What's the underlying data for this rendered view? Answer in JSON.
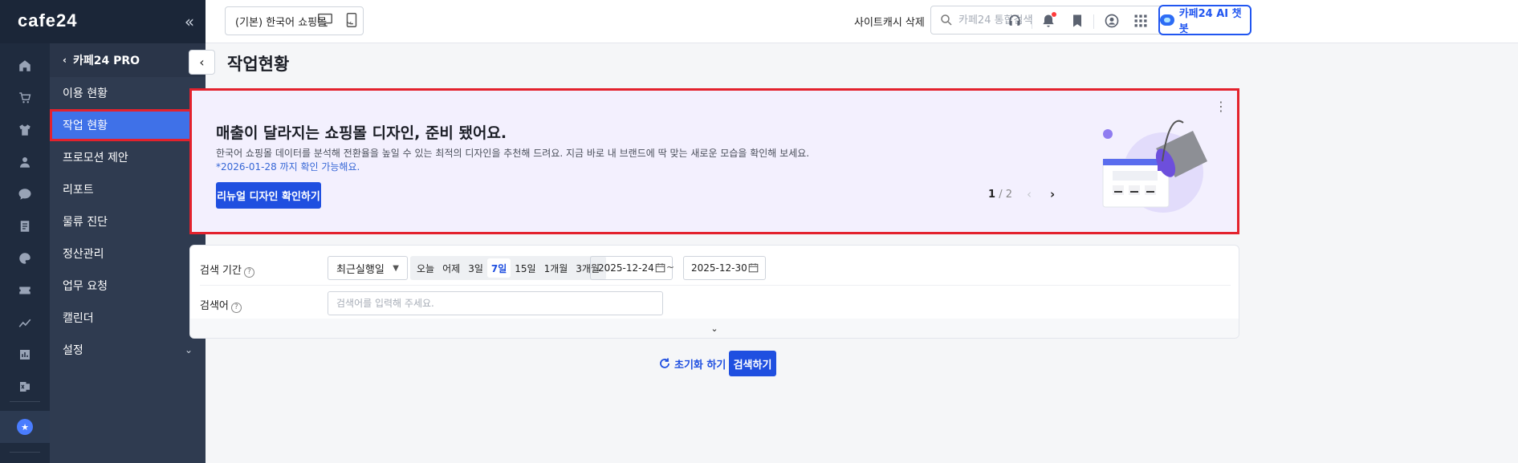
{
  "app": {
    "logo": "cafe24",
    "collapse_label": "«"
  },
  "rail": {
    "icons": [
      "home-icon",
      "cart-icon",
      "shirt-icon",
      "user-icon",
      "chat-icon",
      "document-icon",
      "palette-icon",
      "ticket-icon",
      "chart-line-icon",
      "bar-chart-icon",
      "excel-icon"
    ],
    "active_icon": "pro-badge-icon"
  },
  "submenu": {
    "header": "카페24 PRO",
    "items": [
      {
        "label": "이용 현황"
      },
      {
        "label": "작업 현황"
      },
      {
        "label": "프로모션 제안"
      },
      {
        "label": "리포트"
      },
      {
        "label": "물류 진단"
      },
      {
        "label": "정산관리"
      },
      {
        "label": "업무 요청"
      },
      {
        "label": "캘린더"
      },
      {
        "label": "설정"
      }
    ]
  },
  "topbar": {
    "shop_select": "(기본) 한국어 쇼핑몰",
    "cache_clear": "사이트캐시 삭제",
    "search_placeholder": "카페24 통합검색",
    "ai_button": "카페24 AI 챗봇"
  },
  "page": {
    "title": "작업현황"
  },
  "banner": {
    "title": "매출이 달라지는 쇼핑몰 디자인, 준비 됐어요.",
    "description": "한국어 쇼핑몰 데이터를 분석해 전환율을 높일 수 있는 최적의 디자인을 추천해 드려요. 지금 바로 내 브랜드에 딱 맞는 새로운 모습을 확인해 보세요.",
    "note": "*2026-01-28 까지 확인 가능해요.",
    "cta": "리뉴얼 디자인 확인하기",
    "pager_current": "1",
    "pager_total": "/ 2"
  },
  "filter": {
    "period_label": "검색 기간",
    "period_select": "최근실행일",
    "quick_options": [
      "오늘",
      "어제",
      "3일",
      "7일",
      "15일",
      "1개월",
      "3개월"
    ],
    "active_quick": "7일",
    "date_from": "2025-12-24",
    "date_separator": "~",
    "date_to": "2025-12-30",
    "keyword_label": "검색어",
    "keyword_placeholder": "검색어를 입력해 주세요."
  },
  "actions": {
    "reset": "초기화 하기",
    "search": "검색하기"
  },
  "colors": {
    "primary": "#1f4fe0",
    "highlight": "#e3222d",
    "sidebar": "#2f3b50",
    "banner_bg": "#f3f0fe"
  }
}
